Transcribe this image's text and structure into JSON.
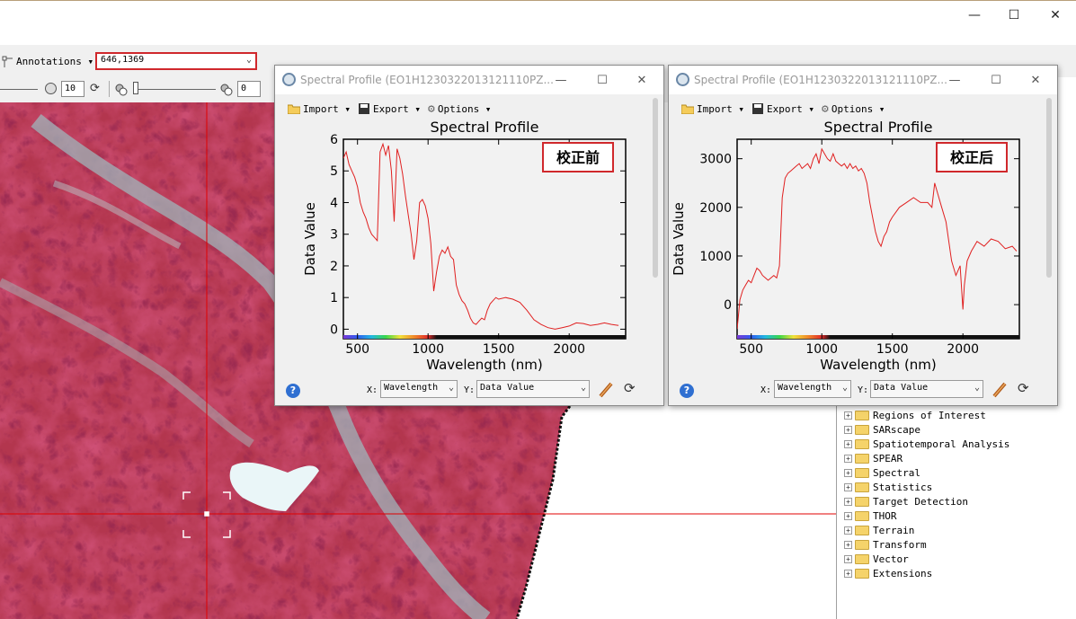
{
  "window": {
    "controls": {
      "minimize": "—",
      "maximize": "☐",
      "close": "✕"
    }
  },
  "toolbar": {
    "annotations_label": "Annotations",
    "coordinate_value": "646,1369",
    "zoom_value": "10",
    "stretch_value": "0"
  },
  "spectral_windows": [
    {
      "title": "Spectral Profile (EO1H1230322013121110PZ...",
      "menu": {
        "import": "Import",
        "export": "Export",
        "options": "Options"
      },
      "x_label_prefix": "X:",
      "y_label_prefix": "Y:",
      "x_select": "Wavelength",
      "y_select": "Data Value",
      "annotation": "校正前",
      "chart_data": {
        "type": "line",
        "title": "Spectral Profile",
        "xlabel": "Wavelength (nm)",
        "ylabel": "Data Value",
        "xlim": [
          400,
          2400
        ],
        "ylim": [
          -0.3,
          6
        ],
        "xticks": [
          "500",
          "1000",
          "1500",
          "2000"
        ],
        "yticks": [
          "0",
          "1",
          "2",
          "3",
          "4",
          "5",
          "6"
        ],
        "series_color": "#e02020",
        "x": [
          400,
          420,
          440,
          460,
          480,
          500,
          520,
          540,
          560,
          580,
          600,
          620,
          640,
          660,
          680,
          700,
          720,
          740,
          760,
          780,
          800,
          820,
          840,
          860,
          880,
          900,
          920,
          940,
          960,
          980,
          1000,
          1020,
          1040,
          1060,
          1080,
          1100,
          1120,
          1140,
          1160,
          1180,
          1200,
          1220,
          1240,
          1260,
          1280,
          1300,
          1320,
          1340,
          1360,
          1380,
          1400,
          1420,
          1440,
          1460,
          1480,
          1500,
          1550,
          1600,
          1650,
          1700,
          1750,
          1800,
          1850,
          1900,
          1950,
          2000,
          2050,
          2100,
          2150,
          2200,
          2250,
          2300,
          2350
        ],
        "y": [
          5.4,
          5.6,
          5.2,
          5.0,
          4.8,
          4.5,
          4.0,
          3.7,
          3.5,
          3.2,
          3.0,
          2.9,
          2.8,
          5.6,
          5.85,
          5.5,
          5.8,
          5.0,
          3.4,
          5.7,
          5.4,
          4.9,
          4.2,
          3.6,
          3.0,
          2.2,
          2.8,
          4.0,
          4.1,
          3.9,
          3.5,
          2.7,
          1.2,
          1.8,
          2.3,
          2.5,
          2.4,
          2.6,
          2.3,
          2.2,
          1.4,
          1.1,
          0.9,
          0.8,
          0.6,
          0.35,
          0.2,
          0.15,
          0.25,
          0.35,
          0.3,
          0.6,
          0.8,
          0.9,
          1.0,
          0.95,
          1.0,
          0.95,
          0.85,
          0.6,
          0.3,
          0.15,
          0.05,
          0.0,
          0.05,
          0.1,
          0.2,
          0.18,
          0.12,
          0.15,
          0.2,
          0.15,
          0.12
        ]
      }
    },
    {
      "title": "Spectral Profile (EO1H1230322013121110PZ...",
      "menu": {
        "import": "Import",
        "export": "Export",
        "options": "Options"
      },
      "x_label_prefix": "X:",
      "y_label_prefix": "Y:",
      "x_select": "Wavelength",
      "y_select": "Data Value",
      "annotation": "校正后",
      "chart_data": {
        "type": "line",
        "title": "Spectral Profile",
        "xlabel": "Wavelength (nm)",
        "ylabel": "Data Value",
        "xlim": [
          400,
          2400
        ],
        "ylim": [
          -700,
          3400
        ],
        "xticks": [
          "500",
          "1000",
          "1500",
          "2000"
        ],
        "yticks": [
          "0",
          "1000",
          "2000",
          "3000"
        ],
        "series_color": "#e02020",
        "x": [
          400,
          410,
          420,
          440,
          460,
          480,
          500,
          520,
          540,
          560,
          580,
          600,
          620,
          640,
          660,
          680,
          700,
          720,
          740,
          760,
          780,
          800,
          820,
          840,
          860,
          880,
          900,
          920,
          940,
          960,
          980,
          1000,
          1020,
          1040,
          1060,
          1080,
          1100,
          1120,
          1140,
          1160,
          1180,
          1200,
          1220,
          1240,
          1260,
          1280,
          1300,
          1320,
          1340,
          1360,
          1380,
          1400,
          1420,
          1440,
          1460,
          1480,
          1500,
          1550,
          1600,
          1650,
          1700,
          1750,
          1780,
          1800,
          1820,
          1850,
          1880,
          1900,
          1920,
          1950,
          1980,
          2000,
          2010,
          2030,
          2060,
          2100,
          2150,
          2200,
          2250,
          2300,
          2350,
          2380
        ],
        "y": [
          -500,
          -200,
          100,
          300,
          400,
          500,
          450,
          600,
          750,
          700,
          600,
          550,
          500,
          550,
          600,
          550,
          800,
          2200,
          2600,
          2700,
          2750,
          2800,
          2850,
          2900,
          2800,
          2850,
          2900,
          2800,
          3000,
          3100,
          2900,
          3200,
          3100,
          3000,
          2950,
          3100,
          2950,
          2900,
          2850,
          2900,
          2800,
          2900,
          2800,
          2850,
          2750,
          2800,
          2700,
          2500,
          2100,
          1800,
          1500,
          1300,
          1200,
          1400,
          1500,
          1700,
          1800,
          2000,
          2100,
          2200,
          2100,
          2100,
          2000,
          2500,
          2300,
          2000,
          1700,
          1300,
          900,
          600,
          800,
          -100,
          400,
          900,
          1100,
          1300,
          1200,
          1350,
          1300,
          1150,
          1200,
          1100
        ]
      }
    }
  ],
  "toolbox": {
    "items": [
      "Regions of Interest",
      "SARscape",
      "Spatiotemporal Analysis",
      "SPEAR",
      "Spectral",
      "Statistics",
      "Target Detection",
      "THOR",
      "Terrain",
      "Transform",
      "Vector",
      "Extensions"
    ]
  },
  "colors": {
    "crosshair": "#e00000",
    "highlight_border": "#d0282c",
    "accent_blue": "#2f6fd1"
  }
}
